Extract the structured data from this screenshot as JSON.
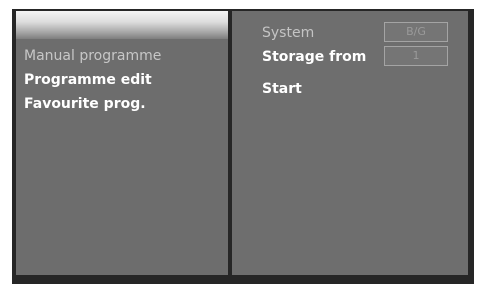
{
  "menu": {
    "items": [
      {
        "label": "Manual programme",
        "active": true
      },
      {
        "label": "Programme edit",
        "active": false
      },
      {
        "label": "Favourite prog.",
        "active": false
      }
    ]
  },
  "settings": {
    "system_label": "System",
    "system_value": "B/G",
    "storage_label": "Storage from",
    "storage_value": "1",
    "start_label": "Start"
  },
  "colors": {
    "panel": "#6d6d6d",
    "frame": "#262626",
    "highlight": "#dcdcdc",
    "text": "#ffffff",
    "text_dim": "#c4c4c4"
  }
}
